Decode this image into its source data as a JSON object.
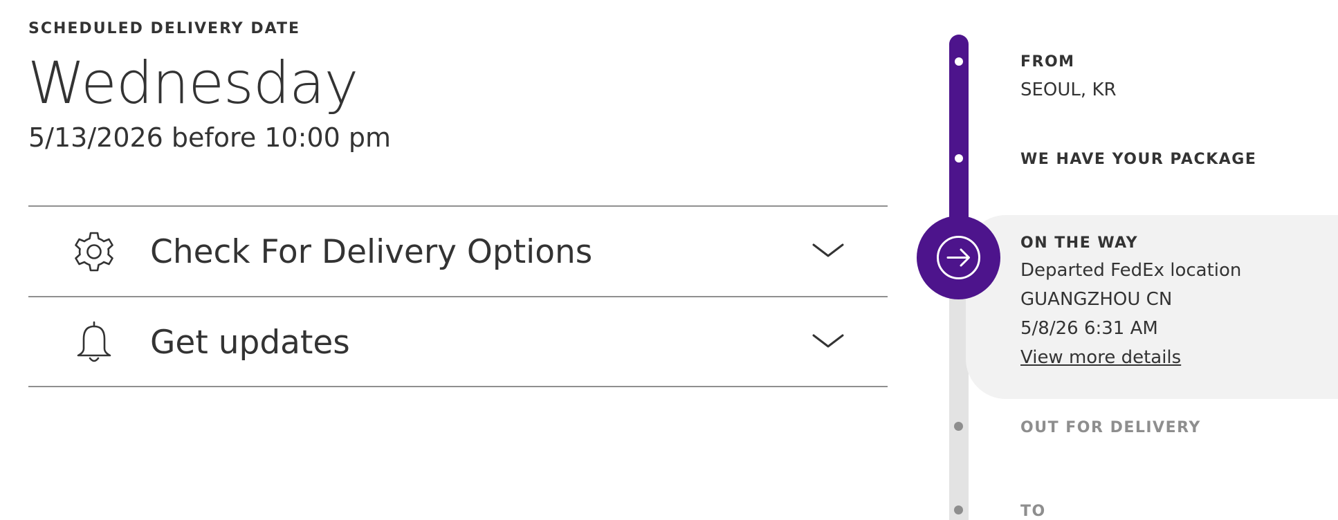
{
  "delivery": {
    "label": "SCHEDULED DELIVERY DATE",
    "day": "Wednesday",
    "date_window": "5/13/2026 before 10:00 pm"
  },
  "panels": [
    {
      "label": "Check For Delivery Options",
      "icon": "gear-icon"
    },
    {
      "label": "Get updates",
      "icon": "bell-icon"
    }
  ],
  "timeline": {
    "from": {
      "label": "FROM",
      "value": "SEOUL, KR"
    },
    "received": {
      "label": "WE HAVE YOUR PACKAGE"
    },
    "current": {
      "label": "ON THE WAY",
      "status": "Departed FedEx location",
      "location": "GUANGZHOU CN",
      "datetime": "5/8/26 6:31 AM",
      "link": "View more details",
      "icon": "arrow-right-icon"
    },
    "out_for_delivery": {
      "label": "OUT FOR DELIVERY"
    },
    "to": {
      "label": "TO"
    }
  },
  "colors": {
    "brand_purple": "#4d148c",
    "text": "#333333",
    "muted": "#8e8e8e",
    "track_gray": "#e3e3e3",
    "highlight_bg": "#f2f2f2"
  }
}
